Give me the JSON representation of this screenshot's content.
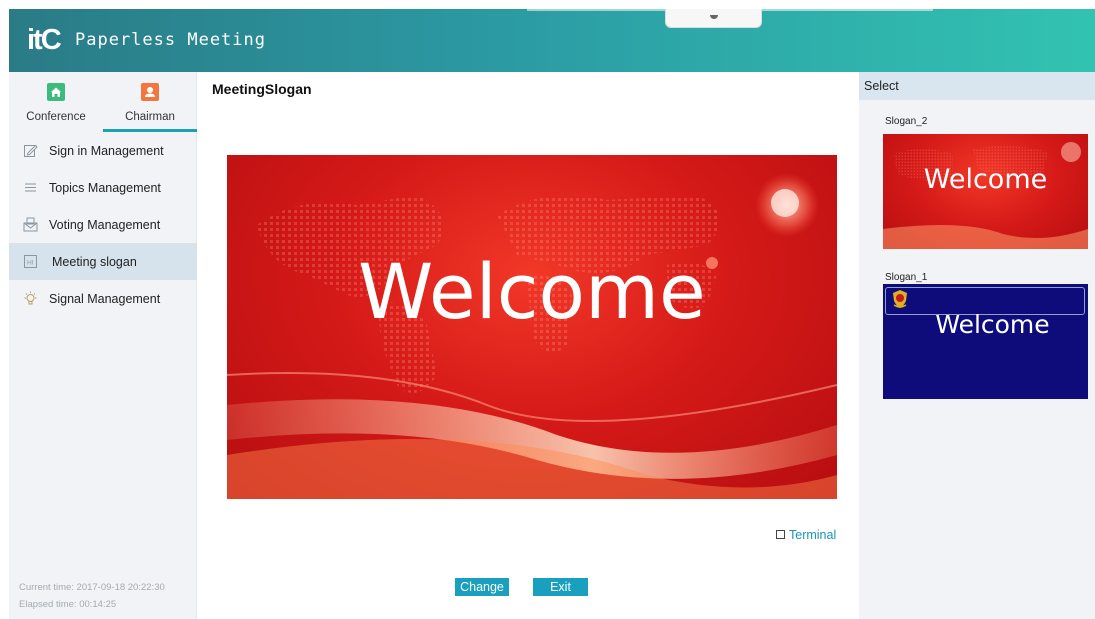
{
  "app": {
    "logo": "itC",
    "title": "Paperless Meeting"
  },
  "roles": [
    {
      "label": "Conference",
      "icon": "home-icon",
      "color": "#3dbb7d"
    },
    {
      "label": "Chairman",
      "icon": "person-icon",
      "color": "#f2773f",
      "selected": true
    }
  ],
  "menu": [
    {
      "label": "Sign in Management",
      "icon": "pencil-icon"
    },
    {
      "label": "Topics Management",
      "icon": "list-icon"
    },
    {
      "label": "Voting Management",
      "icon": "envelope-icon"
    },
    {
      "label": "Meeting slogan",
      "icon": "slogan-icon",
      "active": true
    },
    {
      "label": "Signal Management",
      "icon": "bulb-icon"
    }
  ],
  "status": {
    "current_time": "Current time: 2017-09-18 20:22:30",
    "elapsed_time": "Elapsed time: 00:14:25"
  },
  "main": {
    "title": "MeetingSlogan",
    "preview_text": "Welcome",
    "terminal_label": "Terminal",
    "change_label": "Change",
    "exit_label": "Exit"
  },
  "select": {
    "header": "Select",
    "slogans": [
      {
        "label": "Slogan_2",
        "text": "Welcome",
        "background": "#d51a18"
      },
      {
        "label": "Slogan_1",
        "text": "Welcome",
        "background": "#0d0c7a"
      }
    ]
  },
  "colors": {
    "header_start": "#2a7b86",
    "header_end": "#32c3b2",
    "accent": "#1aa0bf",
    "active_menu": "#d6e3ec"
  }
}
